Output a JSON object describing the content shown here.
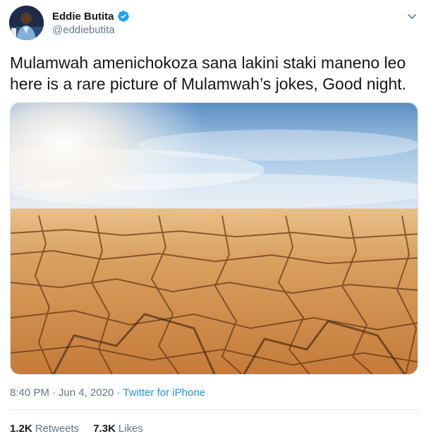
{
  "user": {
    "display_name": "Eddie Butita",
    "handle": "@eddiebutita",
    "verified": true,
    "avatar_icon": "profile-photo"
  },
  "tweet": {
    "text": "Mulamwah amenichokoza sana lakini staki maneno leo\nhere is a rare picture of Mulamwah’s jokes, Good night.",
    "image_description_icon": "cracked-dry-earth-photo"
  },
  "meta": {
    "time": "8:40 PM",
    "separator": "·",
    "date": "Jun 4, 2020",
    "source": "Twitter for iPhone"
  },
  "stats": {
    "retweets_count": "1.2K",
    "retweets_label": "Retweets",
    "likes_count": "7.3K",
    "likes_label": "Likes"
  },
  "colors": {
    "brand_blue": "#1da1f2",
    "link_blue": "#1b95e0",
    "secondary_text": "#657786",
    "primary_text": "#14171a",
    "divider": "#e6ecf0"
  }
}
